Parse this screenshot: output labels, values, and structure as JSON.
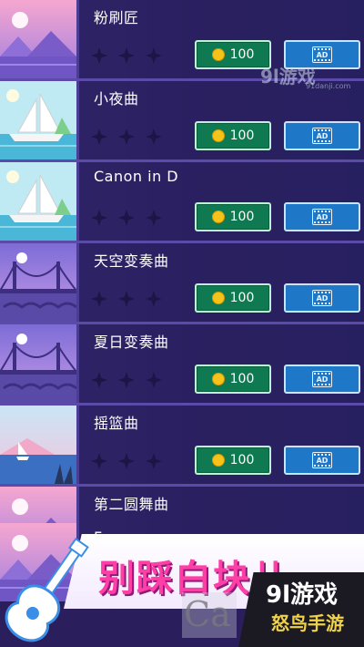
{
  "songs": [
    {
      "title": "粉刷匠",
      "price": "100",
      "art": "pink-lake"
    },
    {
      "title": "小夜曲",
      "price": "100",
      "art": "ship"
    },
    {
      "title": "Canon in D",
      "price": "100",
      "art": "ship"
    },
    {
      "title": "天空变奏曲",
      "price": "100",
      "art": "bridge"
    },
    {
      "title": "夏日变奏曲",
      "price": "100",
      "art": "bridge"
    },
    {
      "title": "摇篮曲",
      "price": "100",
      "art": "sailboat"
    },
    {
      "title": "第二圆舞曲",
      "price": "",
      "art": "pink-lake"
    },
    {
      "title": "Fu",
      "price": "",
      "art": "pink-lake"
    }
  ],
  "ad_label": "AD",
  "banner_title": "别踩白块儿",
  "watermark_top": "9l游戏",
  "watermark_top_sub": "91danji.com",
  "watermark_bottom": "Ca",
  "logo_main": "9l游戏",
  "logo_sub": "怒鸟手游",
  "colors": {
    "coin_button": "#0f7a52",
    "ad_button": "#1f77c8",
    "row_bg": "#2a2060",
    "banner_text": "#ff3ea6"
  }
}
